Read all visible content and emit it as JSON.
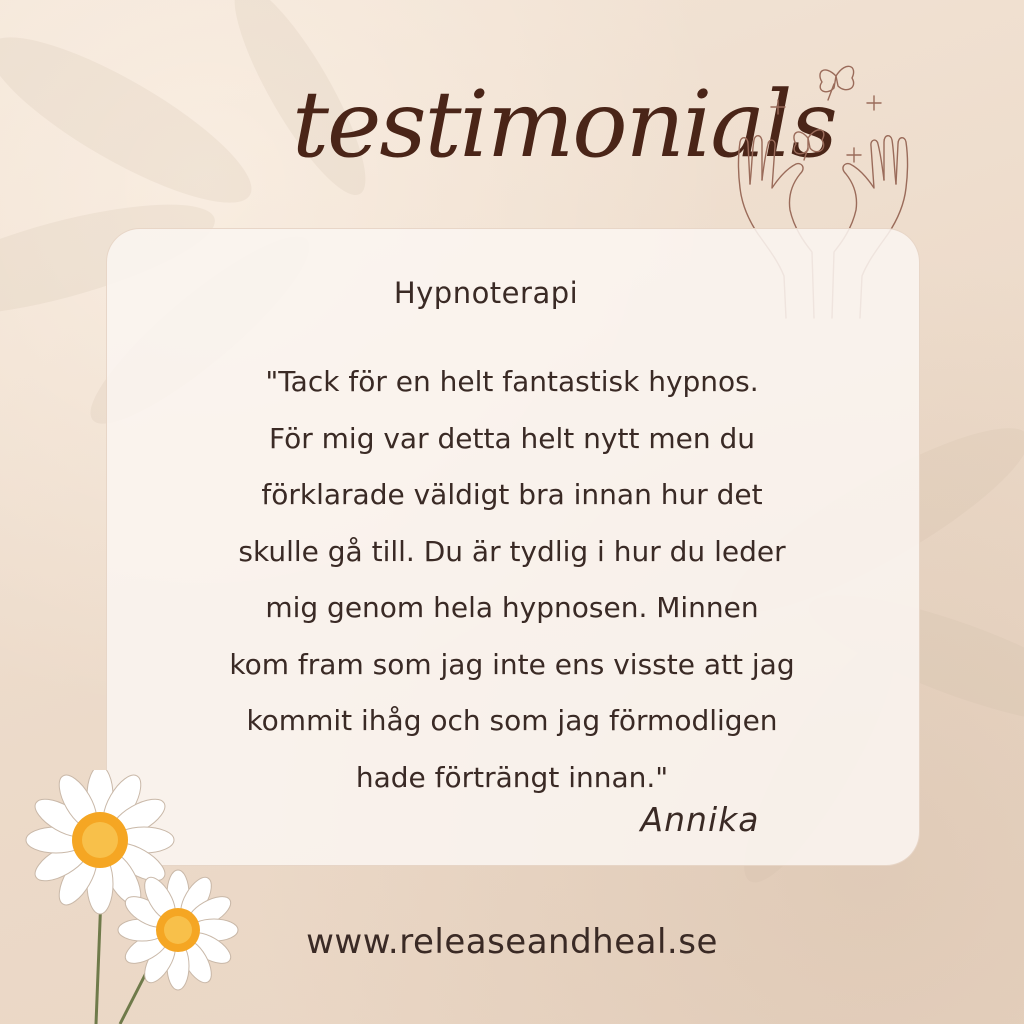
{
  "title": "testimonials",
  "card": {
    "category": "Hypnoterapi",
    "quote_lines": [
      "\"Tack för en helt fantastisk hypnos.",
      "För mig var detta helt nytt men du",
      "förklarade väldigt bra innan hur det",
      "skulle gå till. Du är tydlig i hur du leder",
      "mig genom hela hypnosen. Minnen",
      "kom fram som jag inte ens visste att jag",
      "kommit ihåg och som jag förmodligen",
      "hade förträngt innan.\""
    ],
    "author": "Annika"
  },
  "website": "www.releaseandheal.se",
  "colors": {
    "background": "#efdfd0",
    "card": "#faf5f0",
    "text": "#3a2a25",
    "title": "#4a2518",
    "line_art": "#9a6b5a",
    "daisy_center": "#f5a623"
  },
  "decorations": [
    "hands-with-butterflies-icon",
    "daisy-flowers-icon",
    "leaf-shadow-background"
  ]
}
